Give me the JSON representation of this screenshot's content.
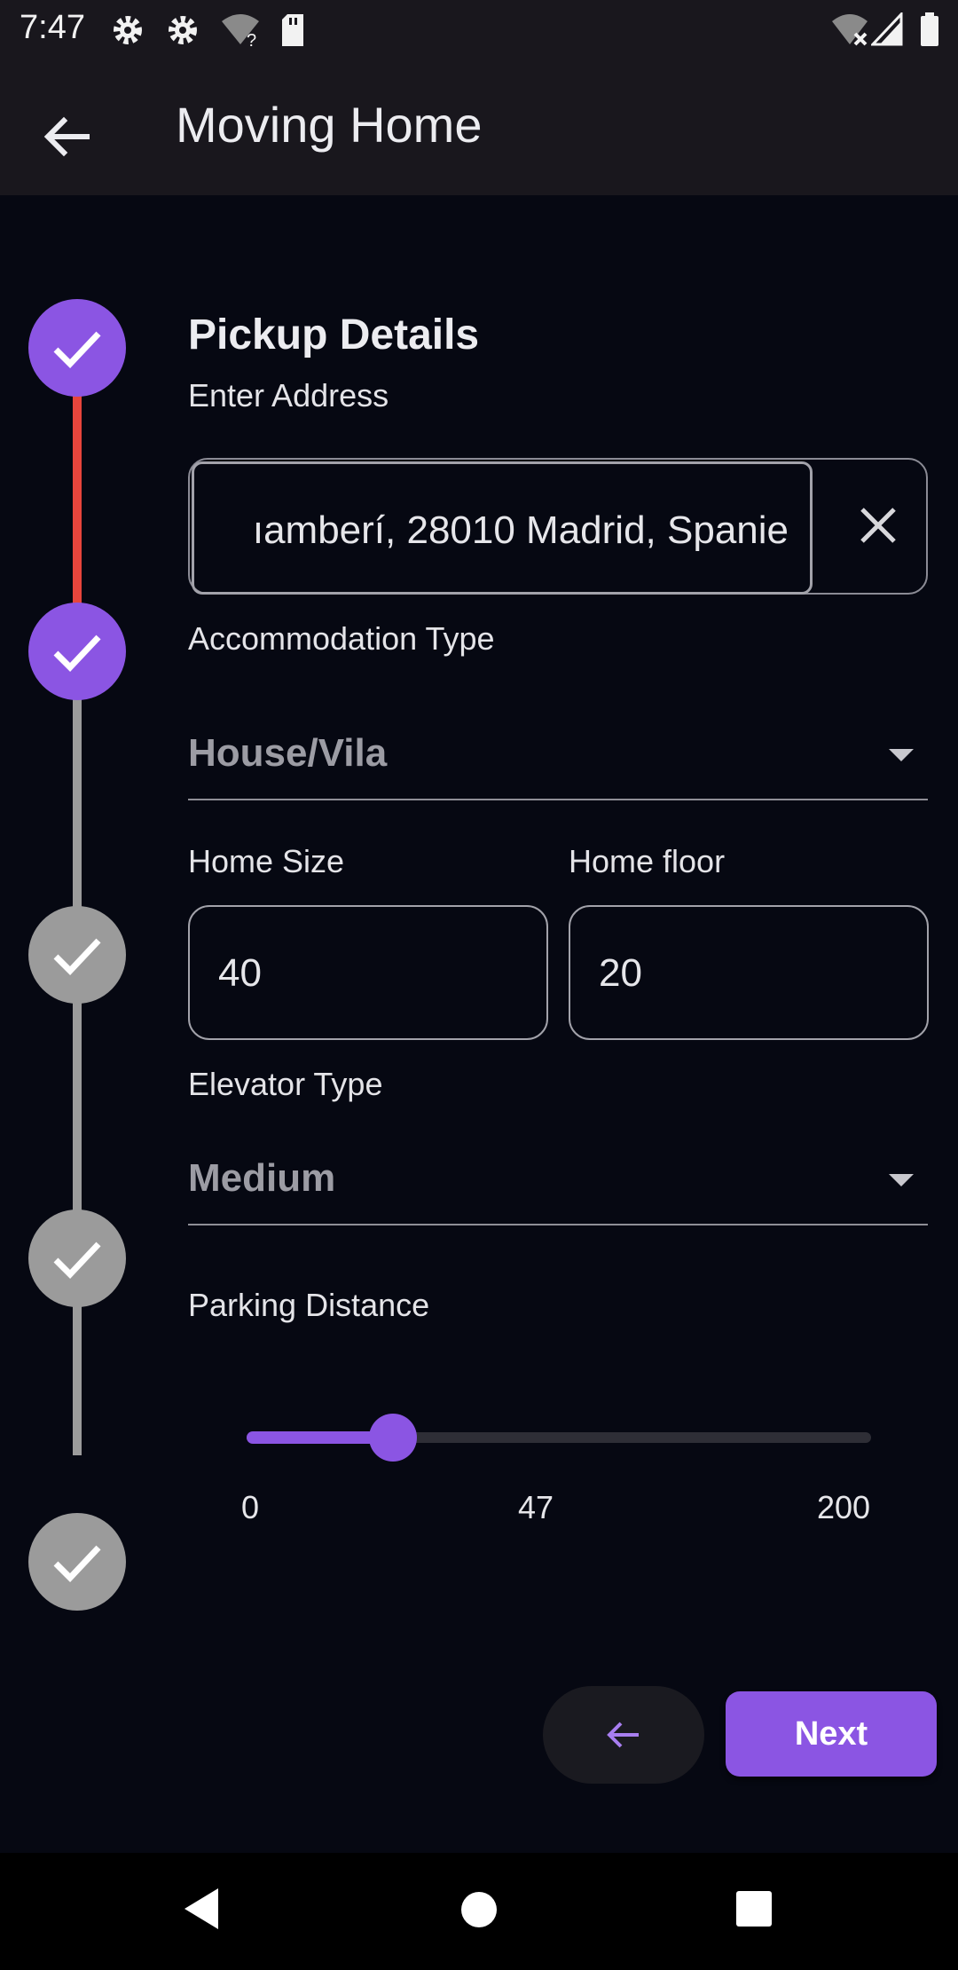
{
  "status_bar": {
    "time": "7:47",
    "icons": [
      "gear-icon",
      "gear-icon",
      "wifi-unknown-icon",
      "sd-card-icon",
      "wifi-off-icon",
      "signal-icon",
      "battery-icon"
    ]
  },
  "app_bar": {
    "title": "Moving Home",
    "back_icon": "arrow-back-icon"
  },
  "stepper": {
    "steps": [
      {
        "state": "completed",
        "icon": "check-icon"
      },
      {
        "state": "completed",
        "icon": "check-icon"
      },
      {
        "state": "inactive",
        "icon": "check-icon"
      },
      {
        "state": "inactive",
        "icon": "check-icon"
      },
      {
        "state": "inactive",
        "icon": "check-icon"
      }
    ],
    "colors": {
      "active": "#8b55e3",
      "inactive": "#9b9b9b",
      "line_active": "#e8453c",
      "line_inactive": "#9b9b9b"
    }
  },
  "form": {
    "section_title": "Pickup Details",
    "address": {
      "label": "Enter Address",
      "value": "ıamberí, 28010 Madrid, Spanie",
      "clear_icon": "close-icon"
    },
    "accommodation": {
      "label": "Accommodation Type",
      "value": "House/Vila"
    },
    "home_size": {
      "label": "Home Size",
      "value": "40"
    },
    "home_floor": {
      "label": "Home floor",
      "value": "20"
    },
    "elevator": {
      "label": "Elevator Type",
      "value": "Medium"
    },
    "parking": {
      "label": "Parking Distance",
      "min": "0",
      "value": "47",
      "max": "200"
    }
  },
  "actions": {
    "back_icon": "arrow-back-icon",
    "next_label": "Next"
  },
  "nav_bar": {
    "icons": [
      "nav-back-icon",
      "nav-home-icon",
      "nav-recents-icon"
    ]
  },
  "colors": {
    "accent": "#8b55e3",
    "background": "#060812",
    "app_bar": "#19171d"
  }
}
